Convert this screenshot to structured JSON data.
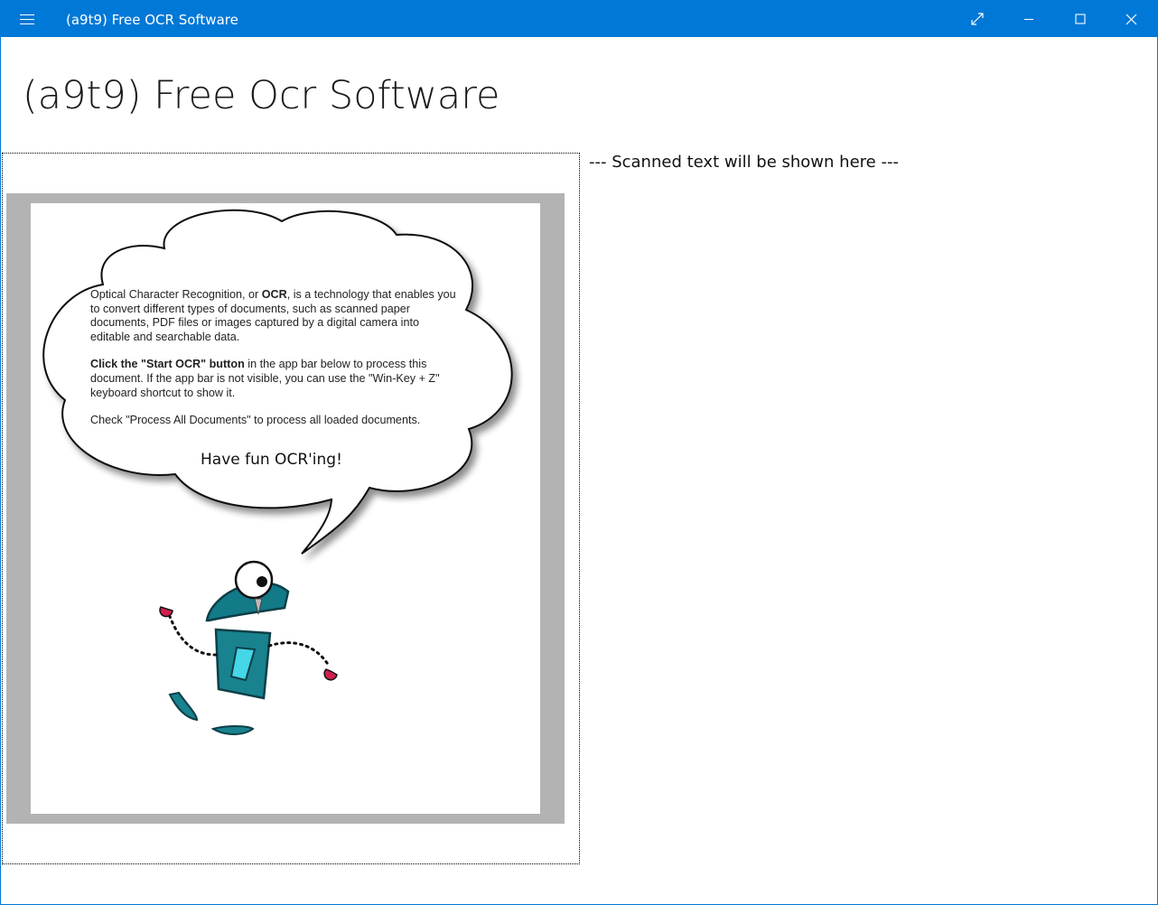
{
  "window": {
    "title": "(a9t9) Free OCR Software",
    "accent_color": "#0078d7",
    "menu_icon": "hamburger-menu-icon",
    "controls": [
      "fullscreen-icon",
      "minimize-icon",
      "maximize-icon",
      "close-icon"
    ]
  },
  "app": {
    "heading": "(a9t9) Free Ocr Software"
  },
  "document": {
    "paragraph1_a": "Optical Character Recognition, or ",
    "paragraph1_bold": "OCR",
    "paragraph1_b": ", is a technology that enables you to convert different types of documents, such as scanned paper documents, PDF files or images captured by a digital camera into editable and searchable data.",
    "paragraph2_bold": "Click the \"Start OCR\" button",
    "paragraph2_rest": " in the app bar below to process this document. If the app bar is not visible, you can use the \"Win-Key + Z\" keyboard shortcut to show it.",
    "paragraph3": "Check \"Process All Documents\" to process all loaded documents.",
    "fun_line": "Have fun OCR'ing!"
  },
  "result": {
    "placeholder_text": "--- Scanned text will be shown here ---"
  }
}
